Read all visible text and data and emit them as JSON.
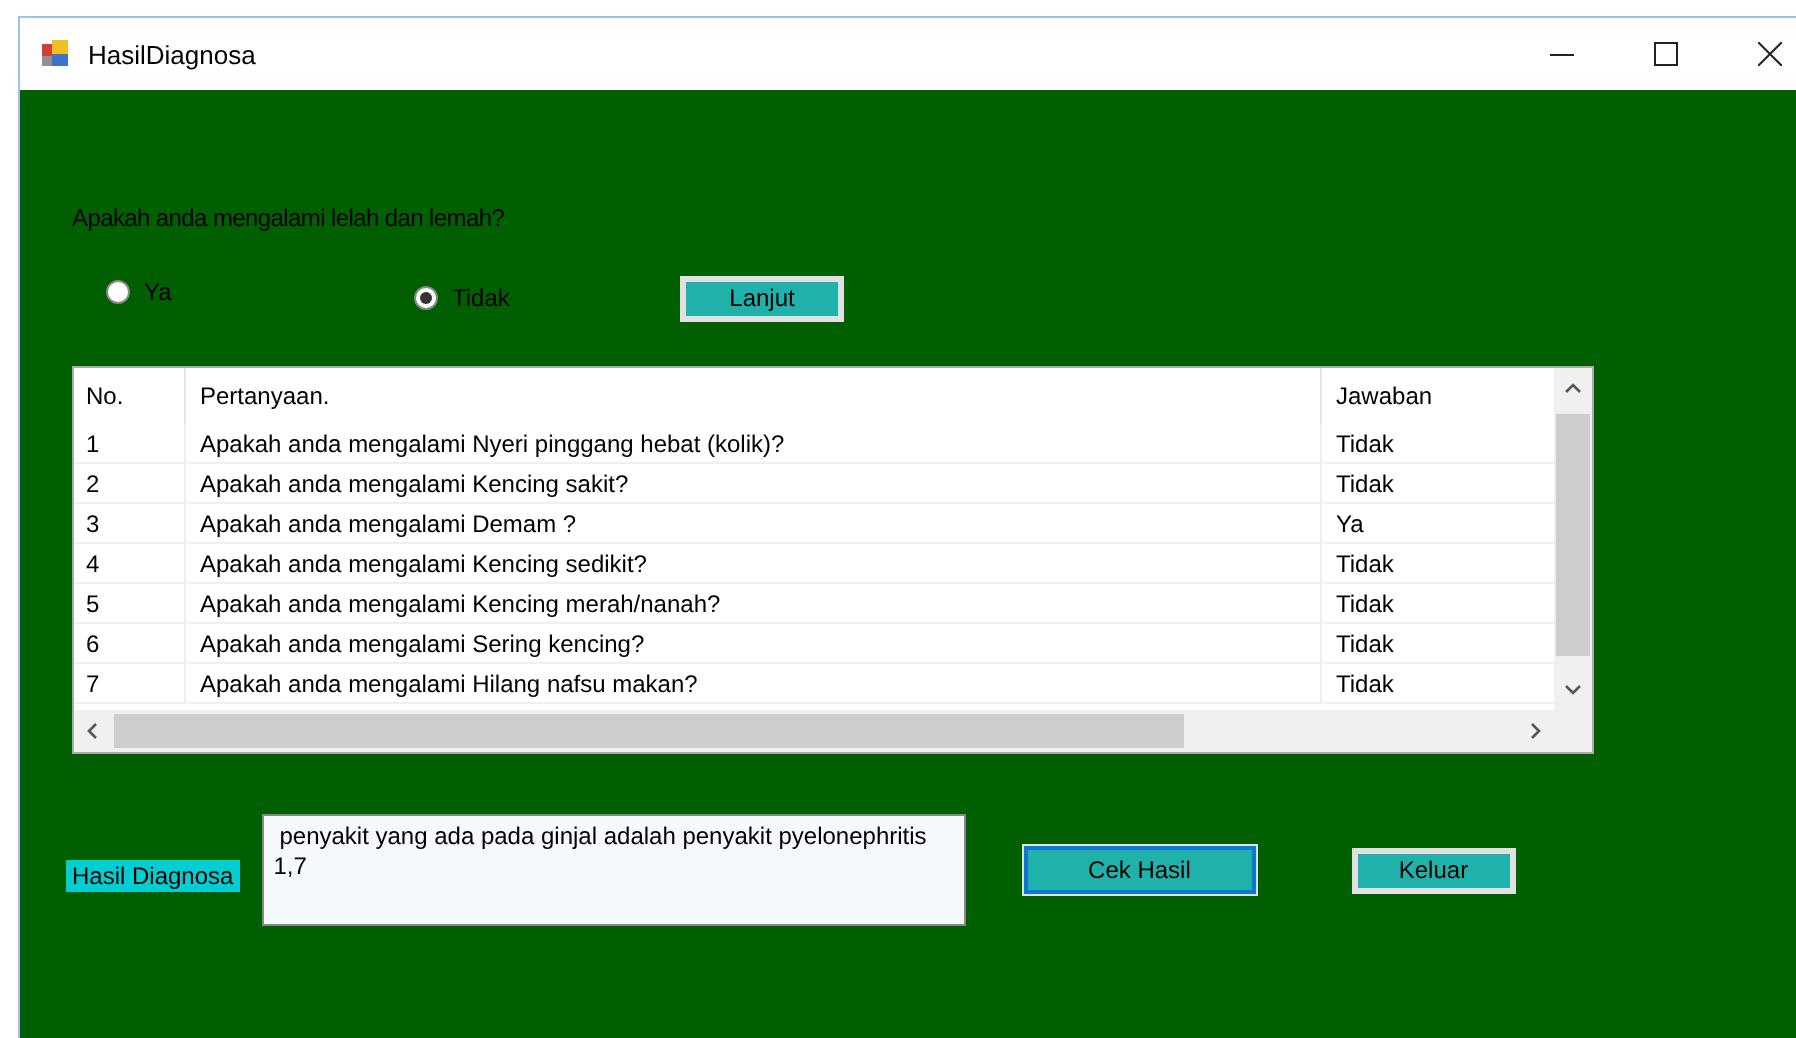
{
  "window": {
    "title": "HasilDiagnosa"
  },
  "question": {
    "text": "Apakah anda mengalami lelah dan lemah?"
  },
  "options": [
    {
      "label": "Ya",
      "selected": false
    },
    {
      "label": "Tidak",
      "selected": true
    }
  ],
  "next_button": {
    "label": "Lanjut"
  },
  "table": {
    "columns": [
      "No.",
      "Pertanyaan.",
      "Jawaban"
    ],
    "rows": [
      [
        "1",
        "Apakah anda mengalami Nyeri pinggang hebat (kolik)?",
        "Tidak"
      ],
      [
        "2",
        "Apakah anda mengalami Kencing sakit?",
        "Tidak"
      ],
      [
        "3",
        "Apakah anda mengalami Demam ?",
        "Ya"
      ],
      [
        "4",
        "Apakah anda mengalami Kencing sedikit?",
        "Tidak"
      ],
      [
        "5",
        "Apakah anda mengalami Kencing merah/nanah?",
        "Tidak"
      ],
      [
        "6",
        "Apakah anda mengalami Sering kencing?",
        "Tidak"
      ],
      [
        "7",
        "Apakah anda mengalami Hilang nafsu makan?",
        "Tidak"
      ]
    ]
  },
  "result": {
    "label": "Hasil Diagnosa",
    "value": "penyakit yang ada pada ginjal adalah penyakit pyelonephritis\n1,7"
  },
  "buttons": [
    {
      "label": "Cek Hasil",
      "focused": true
    },
    {
      "label": "Keluar",
      "focused": false
    }
  ]
}
